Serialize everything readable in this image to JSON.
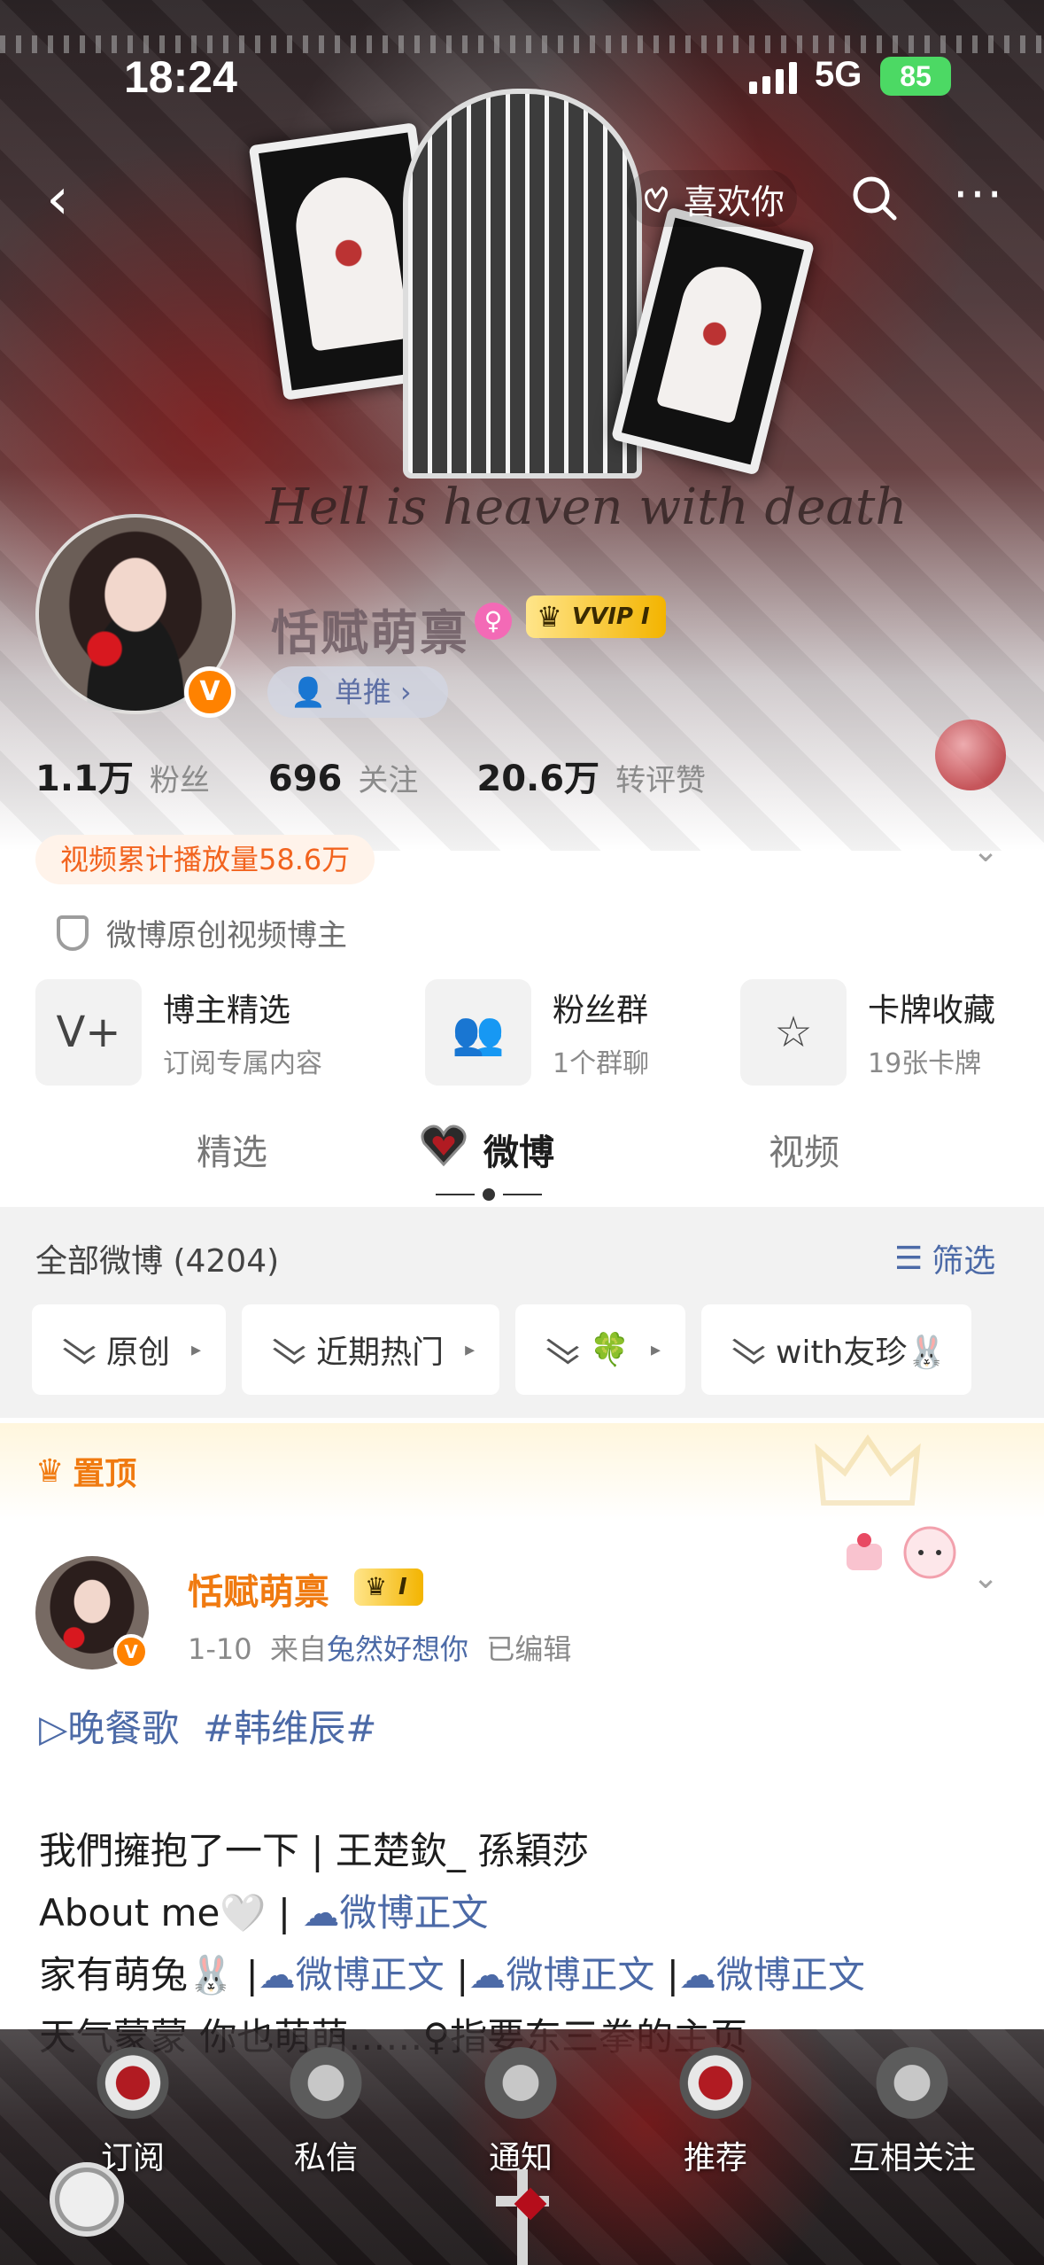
{
  "status_bar": {
    "time": "18:24",
    "network": "5G",
    "battery": "85"
  },
  "nav": {
    "like_label": "喜欢你"
  },
  "banner": {
    "script_text": "Hell is heaven with death"
  },
  "profile": {
    "name": "恬赋萌禀",
    "vip_badge": "VVIP I",
    "single_push_label": "单推",
    "stats": [
      {
        "value": "1.1万",
        "label": "粉丝"
      },
      {
        "value": "696",
        "label": "关注"
      },
      {
        "value": "20.6万",
        "label": "转评赞"
      }
    ],
    "video_plays": "视频累计播放量58.6万",
    "creator_tag": "微博原创视频博主"
  },
  "features": [
    {
      "title": "博主精选",
      "subtitle": "订阅专属内容",
      "icon": "v-plus-icon"
    },
    {
      "title": "粉丝群",
      "subtitle": "1个群聊",
      "icon": "group-icon"
    },
    {
      "title": "卡牌收藏",
      "subtitle": "19张卡牌",
      "icon": "card-icon"
    }
  ],
  "tabs": [
    {
      "label": "精选",
      "active": false
    },
    {
      "label": "微博",
      "active": true
    },
    {
      "label": "视频",
      "active": false
    }
  ],
  "feed": {
    "all_label": "全部微博 (4204)",
    "filter_label": "筛选",
    "chips": [
      "原创",
      "近期热门",
      "🍀",
      "with友珍🐰"
    ]
  },
  "pinned": {
    "label": "置顶",
    "author": "恬赋萌禀",
    "vip": "I",
    "date": "1-10",
    "from_prefix": "来自",
    "source": "兔然好想你",
    "edited": "已编辑",
    "lines": {
      "l1_song": "▷晚餐歌",
      "l1_topic": "#韩维辰#",
      "l2": "我們擁抱了一下 | 王楚欽_ 孫穎莎",
      "l3_a": "About me🤍 | ",
      "l3_link": "微博正文",
      "l4_a": "家有萌兔🐰 |",
      "l4_link1": "微博正文",
      "l4_sep1": " |",
      "l4_link2": "微博正文",
      "l4_sep2": " |",
      "l4_link3": "微博正文",
      "l5": "天气蒙蒙 你也萌萌……♀指要东三拳的主页"
    }
  },
  "bottom_bar": [
    "订阅",
    "私信",
    "通知",
    "推荐",
    "互相关注"
  ],
  "colors": {
    "accent_orange": "#f07a10",
    "link_blue": "#4c6aa7",
    "verified": "#ff8200"
  }
}
